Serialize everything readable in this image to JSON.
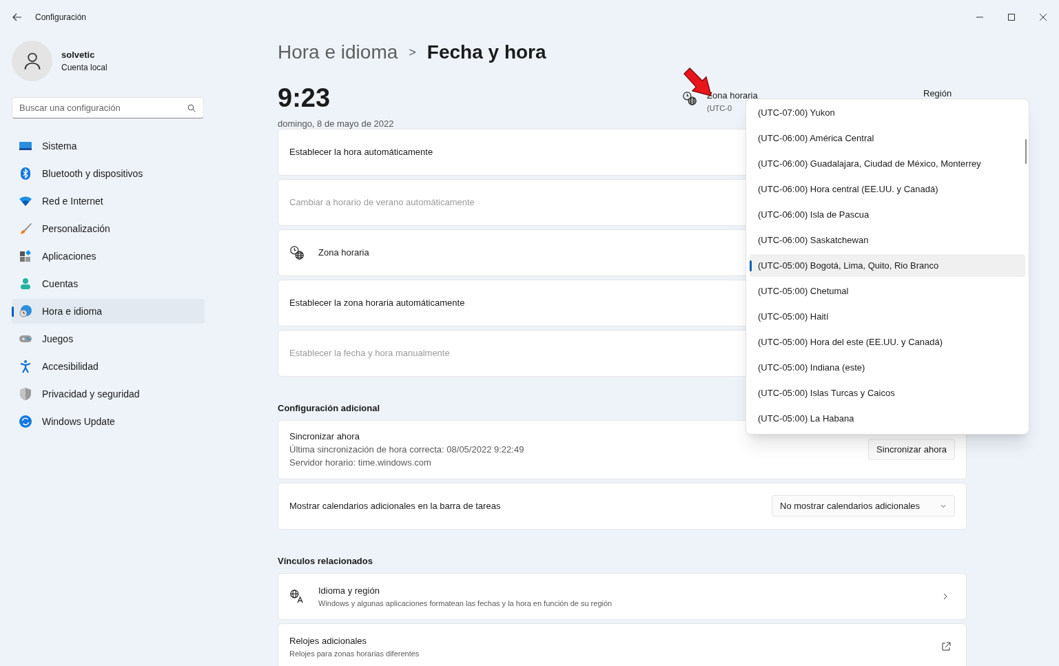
{
  "window": {
    "title": "Configuración"
  },
  "user": {
    "name": "solvetic",
    "account_type": "Cuenta local"
  },
  "search": {
    "placeholder": "Buscar una configuración"
  },
  "sidebar": {
    "items": [
      {
        "label": "Sistema",
        "selected": false
      },
      {
        "label": "Bluetooth y dispositivos",
        "selected": false
      },
      {
        "label": "Red e Internet",
        "selected": false
      },
      {
        "label": "Personalización",
        "selected": false
      },
      {
        "label": "Aplicaciones",
        "selected": false
      },
      {
        "label": "Cuentas",
        "selected": false
      },
      {
        "label": "Hora e idioma",
        "selected": true
      },
      {
        "label": "Juegos",
        "selected": false
      },
      {
        "label": "Accesibilidad",
        "selected": false
      },
      {
        "label": "Privacidad y seguridad",
        "selected": false
      },
      {
        "label": "Windows Update",
        "selected": false
      }
    ]
  },
  "breadcrumb": {
    "parent": "Hora e idioma",
    "separator": ">",
    "current": "Fecha y hora"
  },
  "clock": {
    "time": "9:23",
    "date": "domingo, 8 de mayo de 2022"
  },
  "timezone_summary": {
    "label": "Zona horaria",
    "value": "(UTC-0"
  },
  "region_summary": {
    "label": "Región"
  },
  "settings": [
    {
      "kind": "plain",
      "label": "Establecer la hora automáticamente",
      "disabled": false
    },
    {
      "kind": "plain",
      "label": "Cambiar a horario de verano automáticamente",
      "disabled": true
    },
    {
      "kind": "icon",
      "label": "Zona horaria",
      "disabled": false
    },
    {
      "kind": "plain",
      "label": "Establecer la zona horaria automáticamente",
      "disabled": false
    },
    {
      "kind": "plain",
      "label": "Establecer la fecha y hora manualmente",
      "disabled": true
    }
  ],
  "additional": {
    "heading": "Configuración adicional",
    "sync": {
      "title": "Sincronizar ahora",
      "last_sync": "Última sincronización de hora correcta: 08/05/2022 9:22:49",
      "server": "Servidor horario: time.windows.com",
      "button": "Sincronizar ahora"
    },
    "calendars": {
      "label": "Mostrar calendarios adicionales en la barra de tareas",
      "value": "No mostrar calendarios adicionales"
    }
  },
  "related": {
    "heading": "Vínculos relacionados",
    "links": [
      {
        "kind": "chevron",
        "title": "Idioma y región",
        "description": "Windows y algunas aplicaciones formatean las fechas y la hora en función de su región"
      },
      {
        "kind": "external",
        "title": "Relojes adicionales",
        "description": "Relojes para zonas horarias diferentes"
      }
    ]
  },
  "timezone_dropdown": {
    "options": [
      {
        "label": "(UTC-07:00) Yukon",
        "selected": false
      },
      {
        "label": "(UTC-06:00) América Central",
        "selected": false
      },
      {
        "label": "(UTC-06:00) Guadalajara, Ciudad de México, Monterrey",
        "selected": false
      },
      {
        "label": "(UTC-06:00) Hora central (EE.UU. y Canadá)",
        "selected": false
      },
      {
        "label": "(UTC-06:00) Isla de Pascua",
        "selected": false
      },
      {
        "label": "(UTC-06:00) Saskatchewan",
        "selected": false
      },
      {
        "label": "(UTC-05:00) Bogotá, Lima, Quito, Rio Branco",
        "selected": true
      },
      {
        "label": "(UTC-05:00) Chetumal",
        "selected": false
      },
      {
        "label": "(UTC-05:00) Haití",
        "selected": false
      },
      {
        "label": "(UTC-05:00) Hora del este (EE.UU. y Canadá)",
        "selected": false
      },
      {
        "label": "(UTC-05:00) Indiana (este)",
        "selected": false
      },
      {
        "label": "(UTC-05:00) Islas Turcas y Caicos",
        "selected": false
      },
      {
        "label": "(UTC-05:00) La Habana",
        "selected": false
      }
    ]
  }
}
